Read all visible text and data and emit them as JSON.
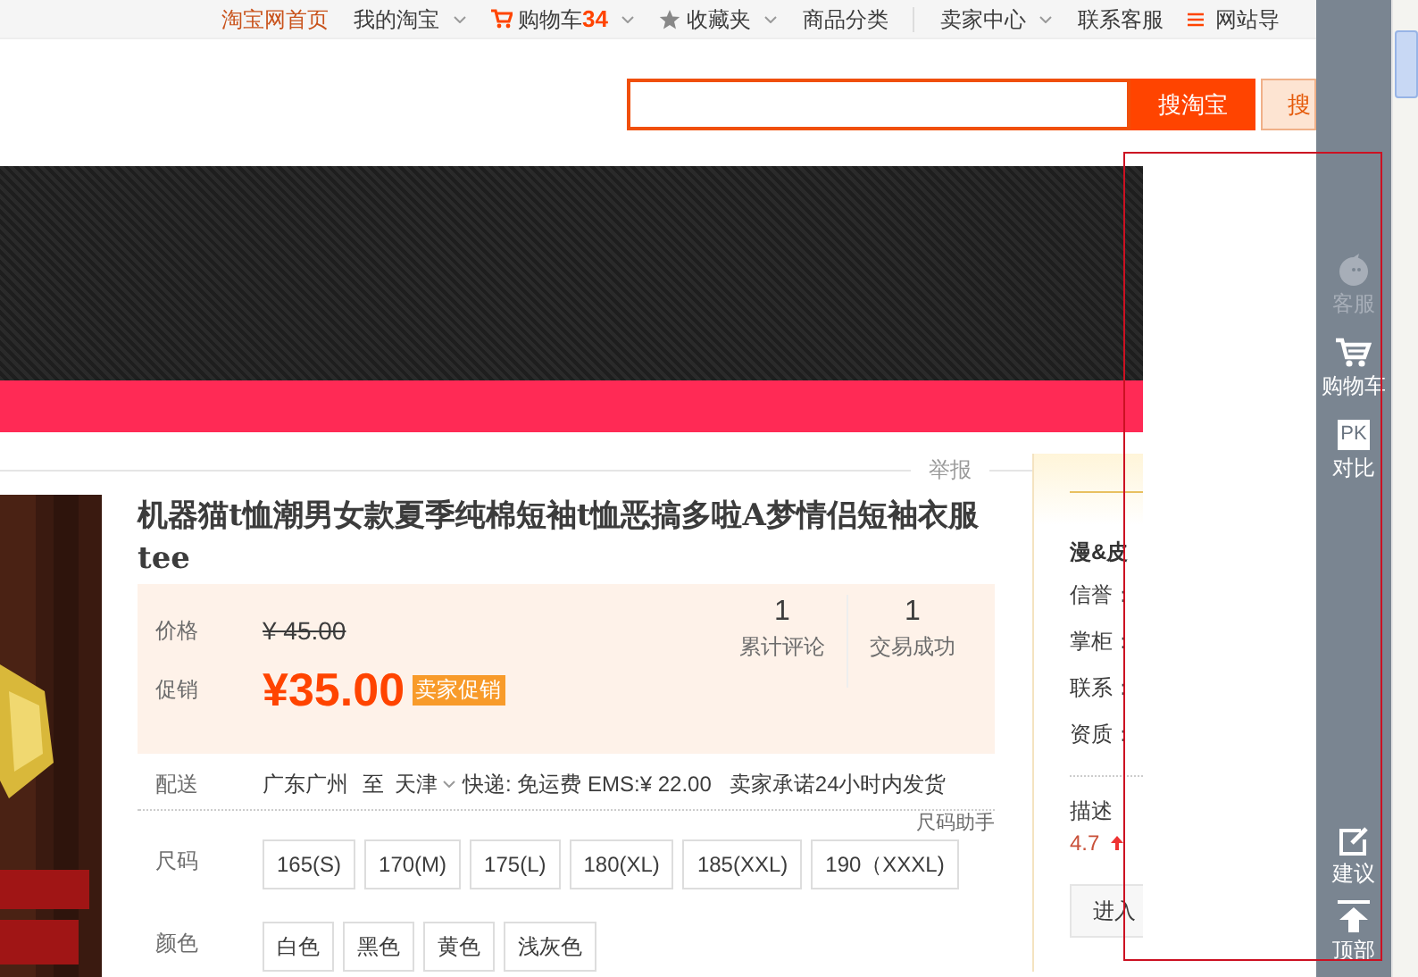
{
  "top_nav": [
    {
      "label": "淘宝网首页",
      "kind": "home",
      "dropdown": false
    },
    {
      "label": "我的淘宝",
      "kind": "plain",
      "dropdown": true
    },
    {
      "label": "购物车",
      "count": "34",
      "kind": "cart",
      "dropdown": true
    },
    {
      "label": "收藏夹",
      "kind": "star",
      "dropdown": true
    },
    {
      "label": "商品分类",
      "kind": "plain",
      "dropdown": false
    },
    {
      "label": "卖家中心",
      "kind": "plain",
      "dropdown": true,
      "divider_before": true
    },
    {
      "label": "联系客服",
      "kind": "plain",
      "dropdown": false
    },
    {
      "label": "网站导",
      "kind": "menu",
      "dropdown": false
    }
  ],
  "search": {
    "buttons": [
      "搜淘宝",
      "搜"
    ]
  },
  "report_link": "举报",
  "product": {
    "title": "机器猫t恤潮男女款夏季纯棉短袖t恤恶搞多啦A梦情侣短袖衣服tee",
    "price_label": "价格",
    "original_price": "¥ 45.00",
    "promo_label": "促销",
    "promo_price": "¥35.00",
    "promo_tag": "卖家促销",
    "stats": [
      {
        "value": "1",
        "label": "累计评论"
      },
      {
        "value": "1",
        "label": "交易成功"
      }
    ],
    "delivery": {
      "label": "配送",
      "from": "广东广州",
      "to": "至",
      "destination": "天津",
      "shipping": "快递: 免运费 EMS:¥ 22.00",
      "promise": "卖家承诺24小时内发货"
    },
    "size_helper": "尺码助手",
    "sizes": {
      "label": "尺码",
      "options": [
        "165(S)",
        "170(M)",
        "175(L)",
        "180(XL)",
        "185(XXL)",
        "190（XXXL)"
      ]
    },
    "colors": {
      "label": "颜色",
      "options": [
        "白色",
        "黑色",
        "黄色",
        "浅灰色"
      ]
    }
  },
  "store": {
    "name": "漫&皮",
    "rows": [
      "信誉：",
      "掌柜：",
      "联系：",
      "资质："
    ],
    "score_label": "描述",
    "score": "4.7",
    "enter_button": "进入"
  },
  "sidebar": {
    "top_items": [
      {
        "label": "客服",
        "kind": "service",
        "disabled": true
      },
      {
        "label": "购物车",
        "kind": "cart",
        "disabled": false
      },
      {
        "label": "对比",
        "kind": "pk",
        "icon_text": "PK",
        "disabled": false
      }
    ],
    "bottom_items": [
      {
        "label": "建议",
        "kind": "feedback",
        "disabled": false
      },
      {
        "label": "顶部",
        "kind": "top",
        "disabled": false
      }
    ]
  }
}
